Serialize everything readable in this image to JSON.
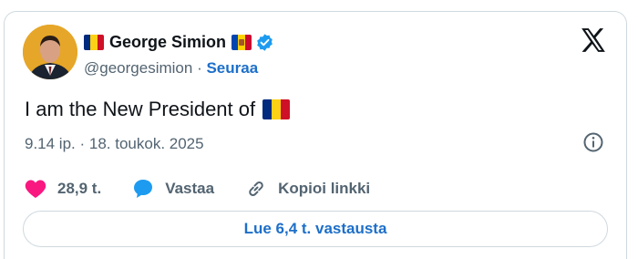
{
  "author": {
    "name": "George Simion",
    "handle": "@georgesimion",
    "separator": "·",
    "follow_label": "Seuraa",
    "avatar_icon": "profile-photo"
  },
  "tweet": {
    "text": "I am the New President of",
    "timestamp": "9.14 ip. · 18. toukok. 2025"
  },
  "actions": {
    "likes_count": "28,9 t.",
    "reply_label": "Vastaa",
    "copy_link_label": "Kopioi linkki"
  },
  "replies_button_label": "Lue 6,4 t. vastausta",
  "colors": {
    "accent": "#1d6fc9",
    "like": "#f91880",
    "text": "#0f1419",
    "muted": "#536471",
    "border": "#cfd9de",
    "flag_blue": "#002b7f",
    "flag_yellow": "#fcd116",
    "flag_red": "#ce1126"
  },
  "icons": [
    "romania-flag-icon",
    "moldova-flag-icon",
    "verified-badge-icon",
    "x-logo-icon",
    "info-icon",
    "heart-icon",
    "reply-icon",
    "link-icon"
  ]
}
